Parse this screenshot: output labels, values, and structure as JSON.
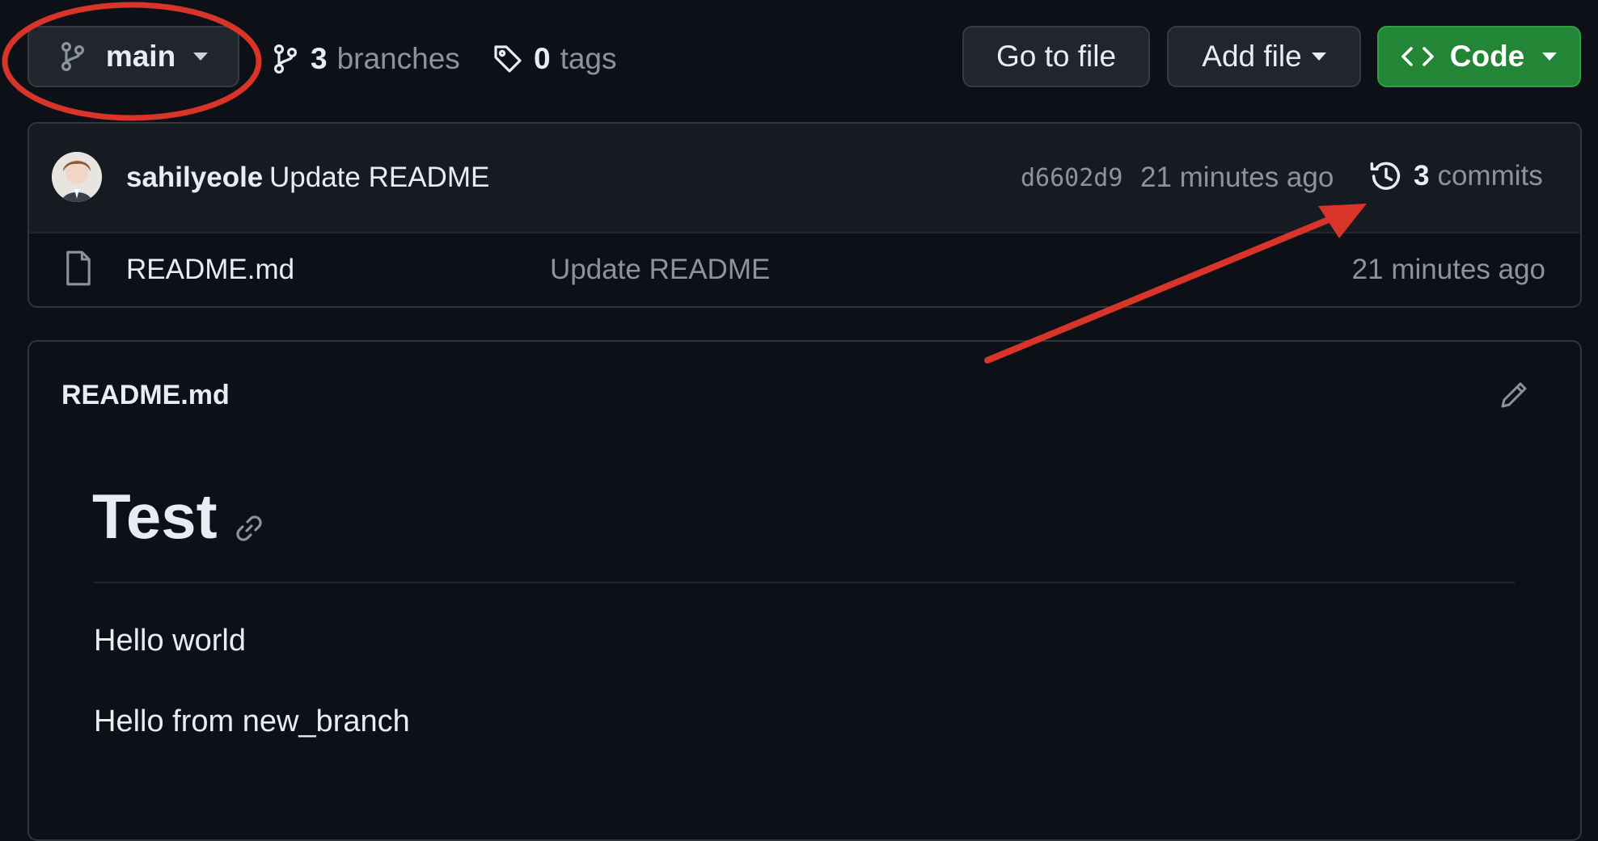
{
  "repo_bar": {
    "branch_button_label": "main",
    "branches_count": "3",
    "branches_label": "branches",
    "tags_count": "0",
    "tags_label": "tags",
    "go_to_file_label": "Go to file",
    "add_file_label": "Add file",
    "code_label": "Code"
  },
  "latest_commit": {
    "author": "sahilyeole",
    "message": "Update README",
    "sha": "d6602d9",
    "time": "21 minutes ago",
    "commits_count": "3",
    "commits_label": "commits"
  },
  "files": [
    {
      "name": "README.md",
      "message": "Update README",
      "time": "21 minutes ago"
    }
  ],
  "readme": {
    "header_title": "README.md",
    "heading": "Test",
    "paragraphs": [
      "Hello world",
      "Hello from new_branch"
    ]
  },
  "colors": {
    "background": "#0d1117",
    "code_button": "#238636",
    "annotation": "#d8342a"
  },
  "annotations": [
    "red ellipse around branch selector",
    "red arrow pointing to commits link"
  ]
}
